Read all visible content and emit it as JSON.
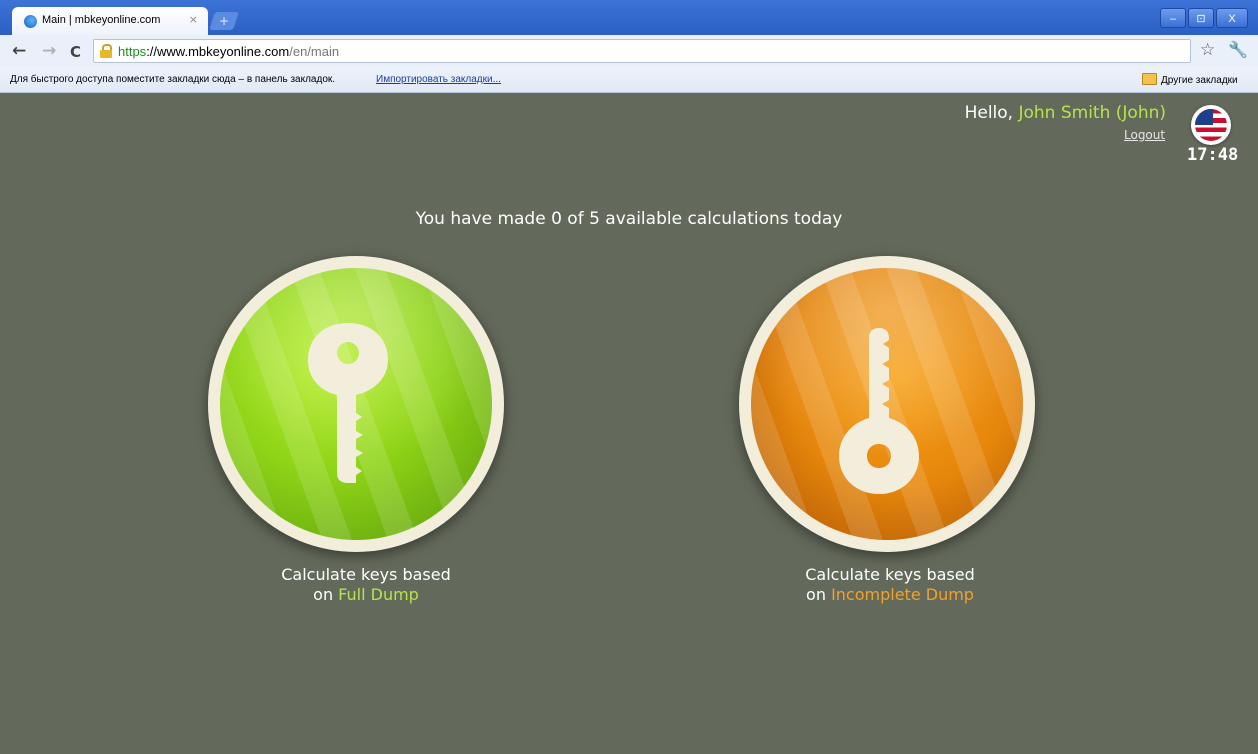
{
  "browser": {
    "tab_title": "Main | mbkeyonline.com",
    "tab_close": "×",
    "new_tab": "+",
    "window_min": "–",
    "window_max": "⊡",
    "window_close": "X",
    "url_scheme": "https",
    "url_host": "://www.mbkeyonline.com",
    "url_path": "/en/main",
    "bookmarks_hint": "Для быстрого доступа поместите закладки сюда – в панель закладок.",
    "bookmarks_import": "Импортировать закладки...",
    "bookmarks_other": "Другие закладки"
  },
  "header": {
    "greeting": "Hello, ",
    "user_name": "John Smith (John)",
    "logout": "Logout",
    "time": "17:48",
    "language_flag": "us-flag-icon"
  },
  "main": {
    "calc_info": "You have made 0 of 5 available calculations today",
    "full": {
      "line1": "Calculate keys based",
      "prefix": "on ",
      "accent": "Full Dump"
    },
    "incomplete": {
      "line1": "Calculate keys based",
      "prefix": "on ",
      "accent": "Incomplete Dump"
    }
  },
  "colors": {
    "page_bg": "#646a5b",
    "accent_green": "#b8e24c",
    "accent_orange": "#f2a12b"
  }
}
